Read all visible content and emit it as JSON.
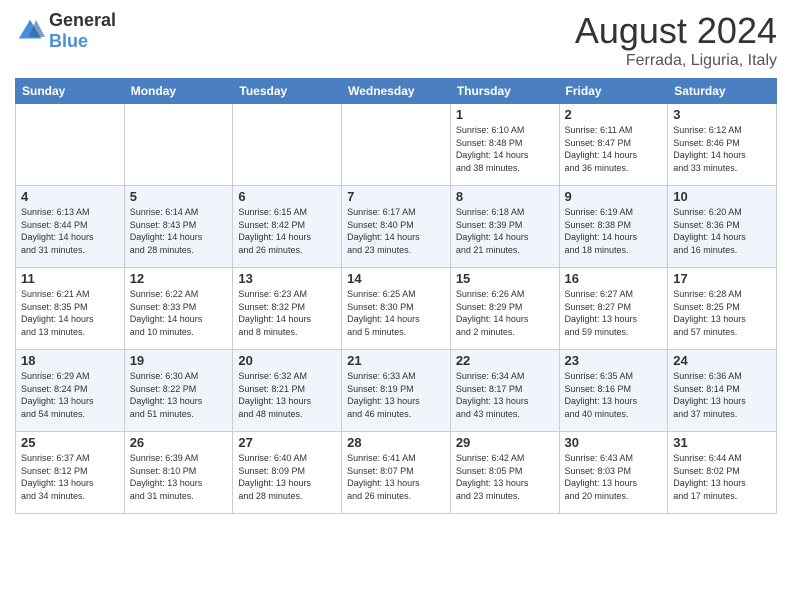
{
  "header": {
    "logo_general": "General",
    "logo_blue": "Blue",
    "month_year": "August 2024",
    "location": "Ferrada, Liguria, Italy"
  },
  "weekdays": [
    "Sunday",
    "Monday",
    "Tuesday",
    "Wednesday",
    "Thursday",
    "Friday",
    "Saturday"
  ],
  "weeks": [
    [
      {
        "day": "",
        "info": ""
      },
      {
        "day": "",
        "info": ""
      },
      {
        "day": "",
        "info": ""
      },
      {
        "day": "",
        "info": ""
      },
      {
        "day": "1",
        "info": "Sunrise: 6:10 AM\nSunset: 8:48 PM\nDaylight: 14 hours\nand 38 minutes."
      },
      {
        "day": "2",
        "info": "Sunrise: 6:11 AM\nSunset: 8:47 PM\nDaylight: 14 hours\nand 36 minutes."
      },
      {
        "day": "3",
        "info": "Sunrise: 6:12 AM\nSunset: 8:46 PM\nDaylight: 14 hours\nand 33 minutes."
      }
    ],
    [
      {
        "day": "4",
        "info": "Sunrise: 6:13 AM\nSunset: 8:44 PM\nDaylight: 14 hours\nand 31 minutes."
      },
      {
        "day": "5",
        "info": "Sunrise: 6:14 AM\nSunset: 8:43 PM\nDaylight: 14 hours\nand 28 minutes."
      },
      {
        "day": "6",
        "info": "Sunrise: 6:15 AM\nSunset: 8:42 PM\nDaylight: 14 hours\nand 26 minutes."
      },
      {
        "day": "7",
        "info": "Sunrise: 6:17 AM\nSunset: 8:40 PM\nDaylight: 14 hours\nand 23 minutes."
      },
      {
        "day": "8",
        "info": "Sunrise: 6:18 AM\nSunset: 8:39 PM\nDaylight: 14 hours\nand 21 minutes."
      },
      {
        "day": "9",
        "info": "Sunrise: 6:19 AM\nSunset: 8:38 PM\nDaylight: 14 hours\nand 18 minutes."
      },
      {
        "day": "10",
        "info": "Sunrise: 6:20 AM\nSunset: 8:36 PM\nDaylight: 14 hours\nand 16 minutes."
      }
    ],
    [
      {
        "day": "11",
        "info": "Sunrise: 6:21 AM\nSunset: 8:35 PM\nDaylight: 14 hours\nand 13 minutes."
      },
      {
        "day": "12",
        "info": "Sunrise: 6:22 AM\nSunset: 8:33 PM\nDaylight: 14 hours\nand 10 minutes."
      },
      {
        "day": "13",
        "info": "Sunrise: 6:23 AM\nSunset: 8:32 PM\nDaylight: 14 hours\nand 8 minutes."
      },
      {
        "day": "14",
        "info": "Sunrise: 6:25 AM\nSunset: 8:30 PM\nDaylight: 14 hours\nand 5 minutes."
      },
      {
        "day": "15",
        "info": "Sunrise: 6:26 AM\nSunset: 8:29 PM\nDaylight: 14 hours\nand 2 minutes."
      },
      {
        "day": "16",
        "info": "Sunrise: 6:27 AM\nSunset: 8:27 PM\nDaylight: 13 hours\nand 59 minutes."
      },
      {
        "day": "17",
        "info": "Sunrise: 6:28 AM\nSunset: 8:25 PM\nDaylight: 13 hours\nand 57 minutes."
      }
    ],
    [
      {
        "day": "18",
        "info": "Sunrise: 6:29 AM\nSunset: 8:24 PM\nDaylight: 13 hours\nand 54 minutes."
      },
      {
        "day": "19",
        "info": "Sunrise: 6:30 AM\nSunset: 8:22 PM\nDaylight: 13 hours\nand 51 minutes."
      },
      {
        "day": "20",
        "info": "Sunrise: 6:32 AM\nSunset: 8:21 PM\nDaylight: 13 hours\nand 48 minutes."
      },
      {
        "day": "21",
        "info": "Sunrise: 6:33 AM\nSunset: 8:19 PM\nDaylight: 13 hours\nand 46 minutes."
      },
      {
        "day": "22",
        "info": "Sunrise: 6:34 AM\nSunset: 8:17 PM\nDaylight: 13 hours\nand 43 minutes."
      },
      {
        "day": "23",
        "info": "Sunrise: 6:35 AM\nSunset: 8:16 PM\nDaylight: 13 hours\nand 40 minutes."
      },
      {
        "day": "24",
        "info": "Sunrise: 6:36 AM\nSunset: 8:14 PM\nDaylight: 13 hours\nand 37 minutes."
      }
    ],
    [
      {
        "day": "25",
        "info": "Sunrise: 6:37 AM\nSunset: 8:12 PM\nDaylight: 13 hours\nand 34 minutes."
      },
      {
        "day": "26",
        "info": "Sunrise: 6:39 AM\nSunset: 8:10 PM\nDaylight: 13 hours\nand 31 minutes."
      },
      {
        "day": "27",
        "info": "Sunrise: 6:40 AM\nSunset: 8:09 PM\nDaylight: 13 hours\nand 28 minutes."
      },
      {
        "day": "28",
        "info": "Sunrise: 6:41 AM\nSunset: 8:07 PM\nDaylight: 13 hours\nand 26 minutes."
      },
      {
        "day": "29",
        "info": "Sunrise: 6:42 AM\nSunset: 8:05 PM\nDaylight: 13 hours\nand 23 minutes."
      },
      {
        "day": "30",
        "info": "Sunrise: 6:43 AM\nSunset: 8:03 PM\nDaylight: 13 hours\nand 20 minutes."
      },
      {
        "day": "31",
        "info": "Sunrise: 6:44 AM\nSunset: 8:02 PM\nDaylight: 13 hours\nand 17 minutes."
      }
    ]
  ]
}
